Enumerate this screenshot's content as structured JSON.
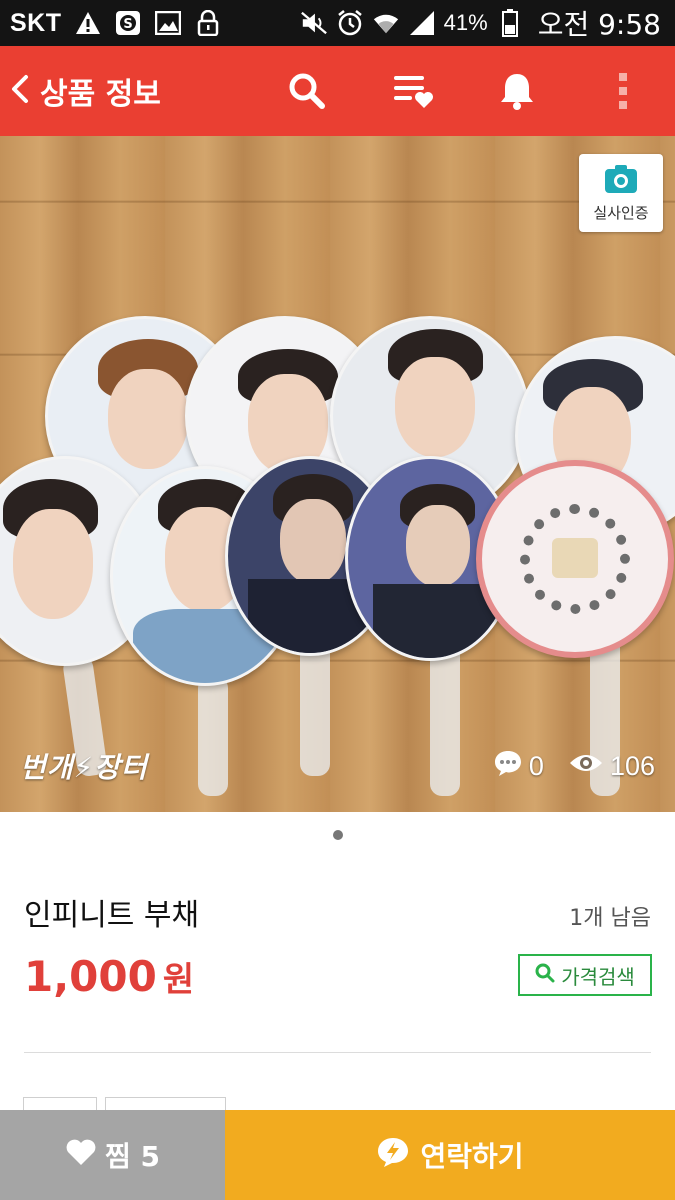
{
  "status_bar": {
    "carrier": "SKT",
    "battery_percent": "41%",
    "time": "오전 9:58"
  },
  "app_bar": {
    "title": "상품 정보",
    "icons": [
      "back-icon",
      "search-icon",
      "wishlist-icon",
      "bell-icon",
      "more-icon"
    ]
  },
  "photo": {
    "verify_label": "실사인증",
    "watermark": "번개⚡장터",
    "comment_count": "0",
    "view_count": "106",
    "page_count": 1,
    "current_page": 1
  },
  "product": {
    "title": "인피니트 부채",
    "stock": "1개 남음",
    "price": "1,000",
    "price_unit": "원",
    "price_search_label": "가격검색"
  },
  "bottom_bar": {
    "like_label": "찜 5",
    "contact_label": "연락하기"
  },
  "colors": {
    "app_bar": "#ea3f32",
    "price": "#e0403a",
    "price_search": "#2ab34a",
    "like_button": "#a5a5a5",
    "contact_button": "#f2ab1f"
  }
}
